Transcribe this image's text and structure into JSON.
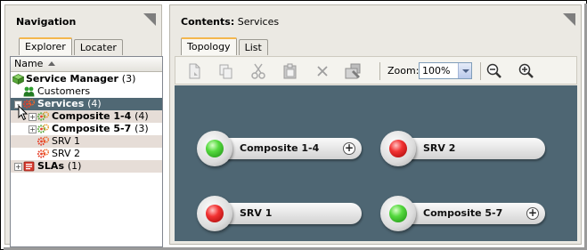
{
  "navigation": {
    "title": "Navigation",
    "tabs": [
      {
        "label": "Explorer",
        "active": true
      },
      {
        "label": "Locater",
        "active": false
      }
    ],
    "column_header": "Name",
    "tree": [
      {
        "label": "Service Manager",
        "count": "(3)",
        "icon": "service-manager-icon",
        "level": 0,
        "expander": "",
        "bold": true
      },
      {
        "label": "Customers",
        "count": "",
        "icon": "customers-icon",
        "level": 1,
        "expander": "",
        "bold": false
      },
      {
        "label": "Services",
        "count": "(4)",
        "icon": "services-icon",
        "level": 1,
        "expander": "-",
        "bold": true,
        "selected": true
      },
      {
        "label": "Composite 1-4",
        "count": "(4)",
        "icon": "composite-service-icon",
        "level": 2,
        "expander": "+",
        "bold": true
      },
      {
        "label": "Composite 5-7",
        "count": "(3)",
        "icon": "composite-service-icon",
        "level": 2,
        "expander": "+",
        "bold": true
      },
      {
        "label": "SRV 1",
        "count": "",
        "icon": "service-icon",
        "level": 2,
        "expander": "",
        "bold": false
      },
      {
        "label": "SRV 2",
        "count": "",
        "icon": "service-icon",
        "level": 2,
        "expander": "",
        "bold": false
      },
      {
        "label": "SLAs",
        "count": "(1)",
        "icon": "sla-icon",
        "level": 1,
        "expander": "+",
        "bold": true
      }
    ]
  },
  "contents": {
    "title_prefix": "Contents:",
    "title_value": "Services",
    "tabs": [
      {
        "label": "Topology",
        "active": true
      },
      {
        "label": "List",
        "active": false
      }
    ],
    "toolbar": {
      "buttons": [
        "new-document-icon",
        "copy-icon",
        "cut-icon",
        "paste-icon",
        "delete-icon",
        "properties-icon"
      ],
      "zoom_label": "Zoom:",
      "zoom_value": "100%",
      "zoom_buttons": [
        "zoom-out-icon",
        "zoom-in-icon"
      ]
    },
    "topology_nodes": [
      {
        "label": "Composite 1-4",
        "status": "green",
        "expandable": true
      },
      {
        "label": "SRV 2",
        "status": "red",
        "expandable": false
      },
      {
        "label": "SRV 1",
        "status": "red",
        "expandable": false
      },
      {
        "label": "Composite 5-7",
        "status": "green",
        "expandable": true
      }
    ]
  },
  "colors": {
    "canvas_bg": "#4e6673",
    "selected_row": "#506874",
    "status_green": "#3fbf2a",
    "status_red": "#d91a1a",
    "tab_highlight": "#f4b74d"
  }
}
